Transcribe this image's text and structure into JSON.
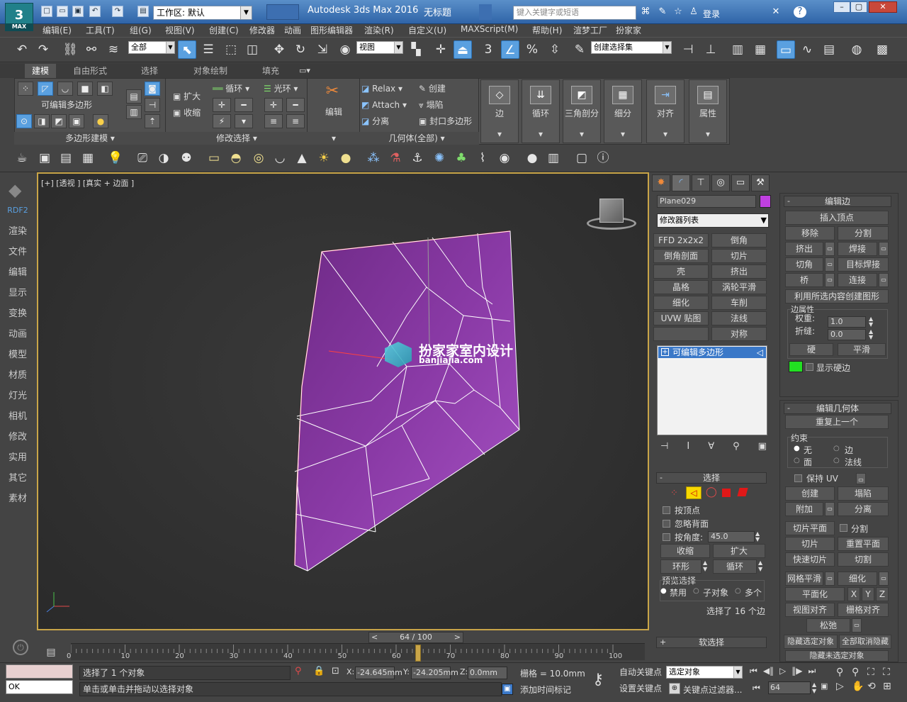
{
  "window": {
    "app_title": "Autodesk 3ds Max 2016",
    "doc_title": "无标题",
    "logo_text": "MAX",
    "workspace_label": "工作区: 默认",
    "search_placeholder": "键入关键字或短语",
    "login_label": "登录"
  },
  "menu": [
    "编辑(E)",
    "工具(T)",
    "组(G)",
    "视图(V)",
    "创建(C)",
    "修改器",
    "动画",
    "图形编辑器",
    "渲染(R)",
    "自定义(U)",
    "MAXScript(M)",
    "帮助(H)",
    "渲梦工厂",
    "扮家家"
  ],
  "main_toolbar": {
    "filter_value": "全部",
    "refcoord_value": "视图",
    "named_sel_value": "创建选择集",
    "snap_label": "3",
    "angle_snap_label": "%"
  },
  "ribbon": {
    "tabs": [
      "建模",
      "自由形式",
      "选择",
      "对象绘制",
      "填充"
    ],
    "editable_poly": "可编辑多边形",
    "group1_label": "多边形建模",
    "grow": "扩大",
    "shrink": "收缩",
    "loop": "循环",
    "ring": "光环",
    "group2_label": "修改选择",
    "edit": "编辑",
    "relax": "Relax",
    "attach": "Attach",
    "detach": "分离",
    "create": "创建",
    "collapse": "塌陷",
    "cap_poly": "封口多边形",
    "group3_label": "几何体(全部)",
    "big_buttons": [
      "边",
      "循环",
      "三角剖分",
      "细分",
      "对齐",
      "属性"
    ]
  },
  "left_panel": {
    "brand": "RDF2",
    "items": [
      "渲染",
      "文件",
      "编辑",
      "显示",
      "变换",
      "动画",
      "模型",
      "材质",
      "灯光",
      "相机",
      "修改",
      "实用",
      "其它",
      "素材"
    ]
  },
  "viewport": {
    "label": "[+] [透视 ] [真实 + 边面 ]",
    "watermark_cn": "扮家家室内设计",
    "watermark_url": "banjiajia.com"
  },
  "command_panel": {
    "object_name": "Plane029",
    "object_color": "#c040e0",
    "modifier_list": "修改器列表",
    "mod_buttons": [
      "FFD 2x2x2",
      "倒角",
      "倒角剖面",
      "切片",
      "壳",
      "挤出",
      "晶格",
      "涡轮平滑",
      "细化",
      "车削",
      "UVW 贴图",
      "法线",
      "",
      "对称"
    ],
    "stack_item": "可编辑多边形",
    "selection": {
      "header": "选择",
      "by_vertex": "按顶点",
      "ignore_backface": "忽略背面",
      "by_angle": "按角度:",
      "angle_value": "45.0",
      "shrink": "收缩",
      "grow": "扩大",
      "ring": "环形",
      "loop": "循环",
      "preview_label": "预览选择",
      "preview_opts": [
        "禁用",
        "子对象",
        "多个"
      ],
      "status": "选择了 16 个边"
    },
    "soft_selection": "软选择",
    "edit_edges": {
      "header": "编辑边",
      "insert_vertex": "插入顶点",
      "remove": "移除",
      "split": "分割",
      "extrude": "挤出",
      "weld": "焊接",
      "chamfer": "切角",
      "target_weld": "目标焊接",
      "bridge": "桥",
      "connect": "连接",
      "create_shape": "利用所选内容创建图形",
      "edge_props": "边属性",
      "weight_label": "权重:",
      "weight_value": "1.0",
      "crease_label": "折缝:",
      "crease_value": "0.0",
      "hard": "硬",
      "smooth": "平滑",
      "show_hard": "显示硬边",
      "hard_color": "#22e022"
    },
    "edit_geometry": {
      "header": "编辑几何体",
      "repeat_last": "重复上一个",
      "constraints": "约束",
      "c_none": "无",
      "c_edge": "边",
      "c_face": "面",
      "c_normal": "法线",
      "preserve_uv": "保持 UV",
      "create": "创建",
      "collapse": "塌陷",
      "attach": "附加",
      "detach": "分离",
      "slice_plane": "切片平面",
      "split": "分割",
      "slice": "切片",
      "reset_plane": "重置平面",
      "quickslice": "快速切片",
      "cut": "切割",
      "meshsmooth": "网格平滑",
      "tessellate": "细化",
      "planarize": "平面化",
      "x": "X",
      "y": "Y",
      "z": "Z",
      "view_align": "视图对齐",
      "grid_align": "栅格对齐",
      "relax": "松弛",
      "hide_selected": "隐藏选定对象",
      "unhide_all": "全部取消隐藏",
      "hide_unselected": "隐藏未选定对象"
    }
  },
  "timeline": {
    "frame_label": "64 / 100",
    "ticks": [
      "0",
      "10",
      "20",
      "30",
      "40",
      "50",
      "60",
      "70",
      "80",
      "90",
      "100"
    ],
    "current_frame": 64
  },
  "status": {
    "selected": "选择了 1 个对象",
    "prompt": "单击或单击并拖动以选择对象",
    "listener": "OK",
    "x_label": "X:",
    "x_value": "-24.645mm",
    "y_label": "Y:",
    "y_value": "-24.205mm",
    "z_label": "Z:",
    "z_value": "0.0mm",
    "grid": "栅格 = 10.0mm",
    "add_time_tag": "添加时间标记",
    "auto_key": "自动关键点",
    "set_key": "设置关键点",
    "selected_obj": "选定对象",
    "key_filters": "关键点过滤器...",
    "frame_value": "64"
  }
}
